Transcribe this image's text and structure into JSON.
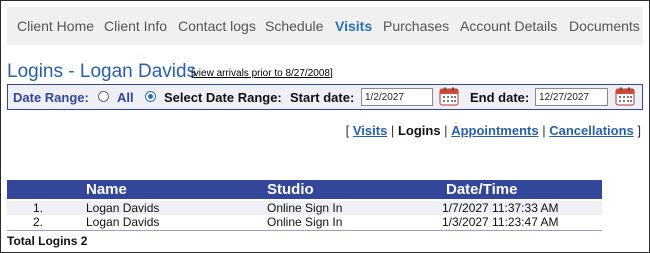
{
  "tabs": [
    {
      "label": "Client Home",
      "active": false
    },
    {
      "label": "Client Info",
      "active": false
    },
    {
      "label": "Contact logs",
      "active": false
    },
    {
      "label": "Schedule",
      "active": false
    },
    {
      "label": "Visits",
      "active": true
    },
    {
      "label": "Purchases",
      "active": false
    },
    {
      "label": "Account Details",
      "active": false
    },
    {
      "label": "Documents",
      "active": false
    }
  ],
  "page": {
    "title": "Logins - Logan Davids",
    "arrivals_link_open": "[",
    "arrivals_link": "view arrivals prior to 8/27/2008",
    "arrivals_link_close": "]"
  },
  "date_range": {
    "label": "Date Range:",
    "option_all": "All",
    "option_select": "Select Date Range:",
    "selected": "select",
    "start_label": "Start date:",
    "start_value": "1/2/2027",
    "end_label": "End date:",
    "end_value": "12/27/2027",
    "calendar_icon": "calendar-icon"
  },
  "subnav": {
    "open": "[",
    "visits": "Visits",
    "sep": "|",
    "logins": "Logins",
    "appointments": "Appointments",
    "cancellations": "Cancellations",
    "close": "]"
  },
  "table": {
    "columns": [
      "Name",
      "Studio",
      "Date/Time"
    ],
    "rows": [
      {
        "num": "1.",
        "name": "Logan Davids",
        "studio": "Online Sign In",
        "datetime": "1/7/2027 11:37:33 AM"
      },
      {
        "num": "2.",
        "name": "Logan Davids",
        "studio": "Online Sign In",
        "datetime": "1/3/2027 11:23:47 AM"
      }
    ],
    "total": "Total Logins 2"
  },
  "colors": {
    "accent": "#34469a",
    "active_tab": "#2a6fb5",
    "tab_bg": "#f0f0f0",
    "row_alt": "#eef0f6"
  }
}
